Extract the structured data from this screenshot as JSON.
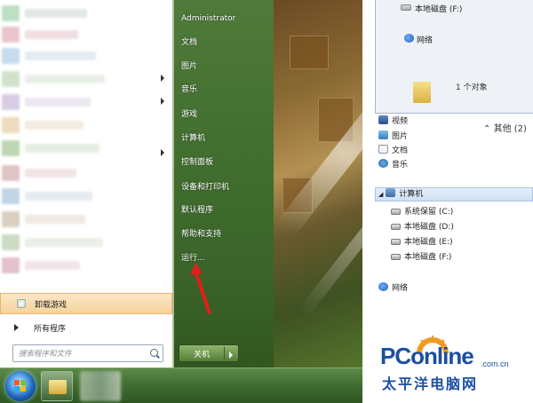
{
  "start_menu": {
    "right_items": [
      {
        "label": "Administrator"
      },
      {
        "label": "文档"
      },
      {
        "label": "图片"
      },
      {
        "label": "音乐"
      },
      {
        "label": "游戏"
      },
      {
        "label": "计算机"
      },
      {
        "label": "控制面板"
      },
      {
        "label": "设备和打印机"
      },
      {
        "label": "默认程序"
      },
      {
        "label": "帮助和支持"
      },
      {
        "label": "运行..."
      }
    ],
    "uninstall_label": "卸载游戏",
    "all_programs_label": "所有程序",
    "search_placeholder": "搜索程序和文件",
    "shutdown_label": "关机"
  },
  "explorer": {
    "drive_f_top": "本地磁盘 (F:)",
    "network_top": "网络",
    "object_count": "1 个对象",
    "other_label": "其他 (2)",
    "nav": {
      "video": "视频",
      "pictures": "图片",
      "documents": "文档",
      "music": "音乐",
      "computer": "计算机",
      "drive_c": "系统保留 (C:)",
      "drive_d": "本地磁盘 (D:)",
      "drive_e": "本地磁盘 (E:)",
      "drive_f": "本地磁盘 (F:)",
      "network": "网络"
    }
  },
  "logo": {
    "main": "PConline",
    "domain": ".com.cn",
    "chinese": "太平洋电脑网"
  },
  "colors": {
    "start_menu_green": "#426f30",
    "highlight_orange": "#f6d39c",
    "logo_blue": "#1b4fa0",
    "annotation_red": "#e0201a"
  }
}
